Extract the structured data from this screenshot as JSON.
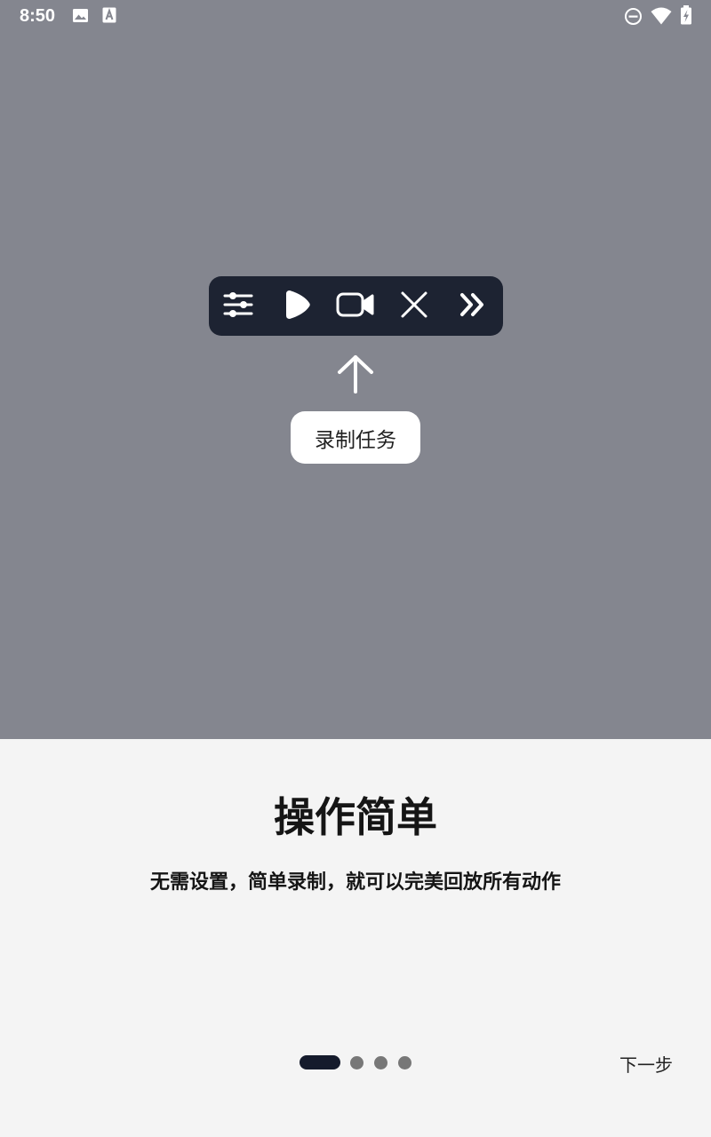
{
  "status_bar": {
    "time": "8:50",
    "left_icons": [
      "image-icon",
      "a-box-icon"
    ],
    "right_icons": [
      "dnd-icon",
      "wifi-icon",
      "battery-icon"
    ]
  },
  "toolbar": {
    "buttons": [
      {
        "icon": "sliders-icon"
      },
      {
        "icon": "play-icon"
      },
      {
        "icon": "video-camera-icon"
      },
      {
        "icon": "close-icon"
      },
      {
        "icon": "double-chevron-right-icon"
      }
    ]
  },
  "tooltip": {
    "label": "录制任务"
  },
  "intro": {
    "title": "操作简单",
    "subtitle": "无需设置，简单录制，就可以完美回放所有动作"
  },
  "pager": {
    "total": 4,
    "current": 1
  },
  "next_button": {
    "label": "下一步"
  },
  "colors": {
    "overlay": "#84868f",
    "toolbar_bg": "#1d2332",
    "panel_bg": "#f4f4f4",
    "active_dot": "#151b2c"
  }
}
